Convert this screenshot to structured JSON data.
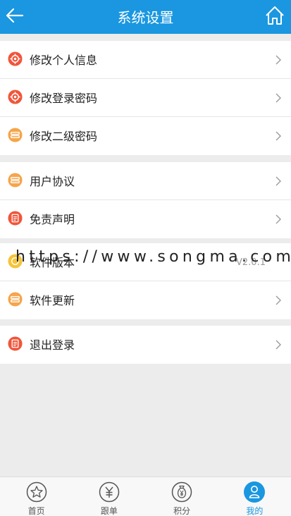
{
  "header": {
    "title": "系统设置",
    "back_icon": "back-arrow-icon",
    "home_icon": "home-icon"
  },
  "groups": [
    {
      "items": [
        {
          "label": "修改个人信息",
          "icon": "gear-icon",
          "color": "#f0553a"
        },
        {
          "label": "修改登录密码",
          "icon": "gear-icon",
          "color": "#f0553a"
        },
        {
          "label": "修改二级密码",
          "icon": "stack-icon",
          "color": "#f5a54a"
        }
      ]
    },
    {
      "items": [
        {
          "label": "用户协议",
          "icon": "stack-icon",
          "color": "#f5a54a"
        },
        {
          "label": "免责声明",
          "icon": "document-icon",
          "color": "#f0553a"
        }
      ]
    },
    {
      "items": [
        {
          "label": "软件版本",
          "icon": "version-icon",
          "color": "#f5c43a",
          "version": "V2.0.1"
        },
        {
          "label": "软件更新",
          "icon": "stack-icon",
          "color": "#f5a54a"
        }
      ]
    },
    {
      "items": [
        {
          "label": "退出登录",
          "icon": "document-icon",
          "color": "#f0553a"
        }
      ]
    }
  ],
  "watermark": "https://www.songma.com",
  "tabbar": [
    {
      "label": "首页",
      "icon": "star-icon",
      "active": false
    },
    {
      "label": "跟单",
      "icon": "yuan-coin-icon",
      "active": false
    },
    {
      "label": "积分",
      "icon": "money-bag-icon",
      "active": false
    },
    {
      "label": "我的",
      "icon": "user-icon",
      "active": true
    }
  ],
  "colors": {
    "accent": "#1a97e0",
    "background": "#ececec"
  }
}
